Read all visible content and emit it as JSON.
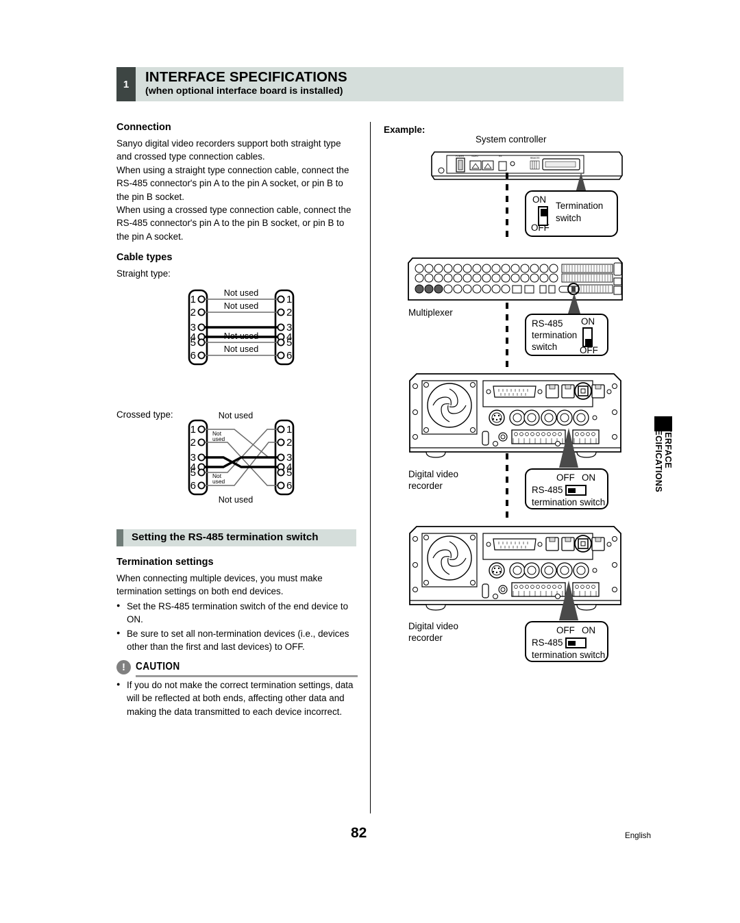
{
  "header": {
    "number": "1",
    "title": "INTERFACE SPECIFICATIONS",
    "subtitle": "(when optional interface board is installed)"
  },
  "left": {
    "connection": {
      "heading": "Connection",
      "paragraphs": [
        "Sanyo digital video recorders support both straight type and crossed type connection cables.",
        "When using a straight type connection cable, connect the RS-485 connector's pin A to the pin A socket, or pin B to the pin B socket.",
        "When using a crossed type connection cable, connect the RS-485 connector's pin A to the pin B socket, or pin B to the pin A socket."
      ]
    },
    "cable_types": {
      "heading": "Cable types",
      "straight_label": "Straight type:",
      "crossed_label": "Crossed type:",
      "not_used_label": "Not used",
      "pins": [
        "1",
        "2",
        "3",
        "4",
        "5",
        "6"
      ]
    },
    "section": {
      "title": "Setting the RS-485 termination switch",
      "heading": "Termination settings",
      "intro": "When connecting multiple devices, you must make termination settings on both end devices.",
      "bullets": [
        "Set the RS-485 termination switch of the end device to ON.",
        "Be sure to set all non-termination devices (i.e., devices other than the first and last devices) to OFF."
      ]
    },
    "caution": {
      "mark": "!",
      "title": "CAUTION",
      "bullets": [
        "If you do not make the correct termination settings, data will be reflected at both ends, affecting other data and making the data transmitted to each device incorrect."
      ]
    }
  },
  "right": {
    "example_label": "Example:",
    "devices": [
      {
        "name": "system-controller",
        "label": "System controller"
      },
      {
        "name": "multiplexer",
        "label": "Multiplexer"
      },
      {
        "name": "digital-video-recorder-1",
        "label": "Digital video\nrecorder"
      },
      {
        "name": "digital-video-recorder-2",
        "label": "Digital video\nrecorder"
      }
    ],
    "callouts": [
      {
        "name": "termination-switch-system-controller",
        "label": "Termination\nswitch",
        "on": "ON",
        "off": "OFF",
        "orientation": "vertical",
        "position": "ON"
      },
      {
        "name": "rs485-termination-switch-multiplexer",
        "label": "RS-485\ntermination\nswitch",
        "on": "ON",
        "off": "OFF",
        "orientation": "vertical",
        "position": "OFF"
      },
      {
        "name": "rs485-termination-switch-dvr-1",
        "label": "RS-485\ntermination switch",
        "on": "ON",
        "off": "OFF",
        "orientation": "horizontal",
        "position": "OFF"
      },
      {
        "name": "rs485-termination-switch-dvr-2",
        "label": "RS-485\ntermination switch",
        "on": "ON",
        "off": "OFF",
        "orientation": "horizontal",
        "position": "OFF"
      }
    ]
  },
  "side_tab": {
    "line1": "INTERFACE",
    "line2": "SPECIFICATIONS"
  },
  "footer": {
    "page_number": "82",
    "language": "English"
  }
}
